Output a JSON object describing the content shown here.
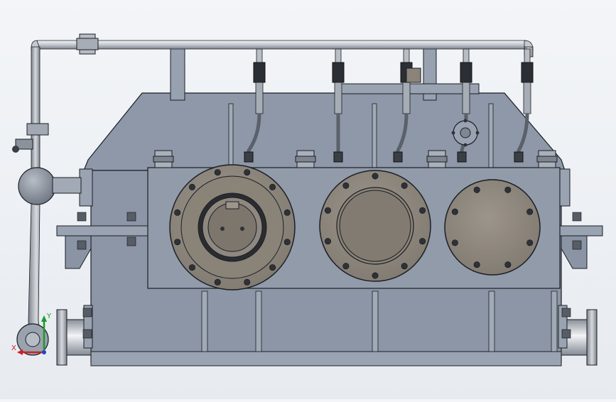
{
  "viewport": {
    "description_visible": false,
    "background": "#eef1f5"
  },
  "colors": {
    "housing": "#8e98a8",
    "housing_dark": "#6f7888",
    "outline": "#1b1e24",
    "cover": "#8a8278",
    "cover_light": "#a29b92",
    "pipe": "#c9cdd3",
    "bolt": "#2e3238",
    "axis_x": "#cc2222",
    "axis_y": "#1a9a2a",
    "axis_z": "#2244cc"
  },
  "triad": {
    "x_label": "X",
    "y_label": "Y"
  },
  "components": {
    "covers": [
      "bearing-cover-input",
      "bearing-cover-intermediate",
      "bearing-cover-output"
    ],
    "sensors": 5
  }
}
